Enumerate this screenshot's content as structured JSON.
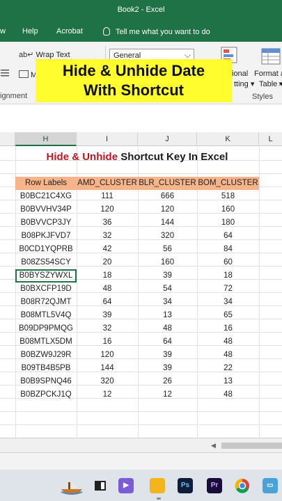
{
  "window": {
    "title": "Book2  -  Excel"
  },
  "menu": {
    "items": [
      "w",
      "Help",
      "Acrobat"
    ],
    "tell_me": "Tell me what you want to do"
  },
  "ribbon": {
    "wrap_text": "Wrap Text",
    "merge_partial": "M",
    "number_format": "General",
    "cond_format_partial": "ional",
    "cond_format_partial2": "tting ▾",
    "format_as": "Format a",
    "table": "Table ▾",
    "styles_group": "Styles",
    "alignment_group": "ignment"
  },
  "overlay": {
    "line1": "Hide & Unhide Date",
    "line2": "With Shortcut"
  },
  "columns": [
    "H",
    "I",
    "J",
    "K",
    "L"
  ],
  "sheet": {
    "title_red": "Hide & Unhide",
    "title_dark": " Shortcut Key In Excel",
    "headers": [
      "Row Labels",
      "AMD_CLUSTER",
      "BLR_CLUSTER",
      "BOM_CLUSTER"
    ],
    "rows": [
      [
        "B0BC21C4XG",
        "111",
        "666",
        "518"
      ],
      [
        "B0BVVHV34P",
        "120",
        "120",
        "160"
      ],
      [
        "B0BVVCP3JY",
        "36",
        "144",
        "180"
      ],
      [
        "B08PKJFVD7",
        "32",
        "320",
        "64"
      ],
      [
        "B0CD1YQPRB",
        "42",
        "56",
        "84"
      ],
      [
        "B08ZS54SCY",
        "20",
        "160",
        "60"
      ],
      [
        "B0BYSZYWXL",
        "18",
        "39",
        "18"
      ],
      [
        "B0BXCFP19D",
        "48",
        "54",
        "72"
      ],
      [
        "B08R72QJMT",
        "64",
        "34",
        "34"
      ],
      [
        "B08MTL5V4Q",
        "39",
        "13",
        "65"
      ],
      [
        "B09DP9PMQG",
        "32",
        "48",
        "16"
      ],
      [
        "B08MTLX5DM",
        "16",
        "64",
        "48"
      ],
      [
        "B0BZW9J29R",
        "120",
        "39",
        "48"
      ],
      [
        "B09TB4B5PB",
        "144",
        "39",
        "22"
      ],
      [
        "B0B9SPNQ46",
        "320",
        "26",
        "13"
      ],
      [
        "B0BZPCKJ1Q",
        "12",
        "12",
        "48"
      ]
    ]
  },
  "taskbar": {
    "icons": [
      "boat-icon",
      "window-icon",
      "video-call-icon",
      "folder-icon",
      "photoshop-icon",
      "premiere-icon",
      "chrome-icon",
      "monitor-icon"
    ],
    "ps": "Ps",
    "pr": "Pr"
  },
  "colors": {
    "excel_green": "#1f7246",
    "header_fill": "#f6b48a",
    "title_red": "#c0151f",
    "overlay_yellow": "#fffd2e"
  }
}
